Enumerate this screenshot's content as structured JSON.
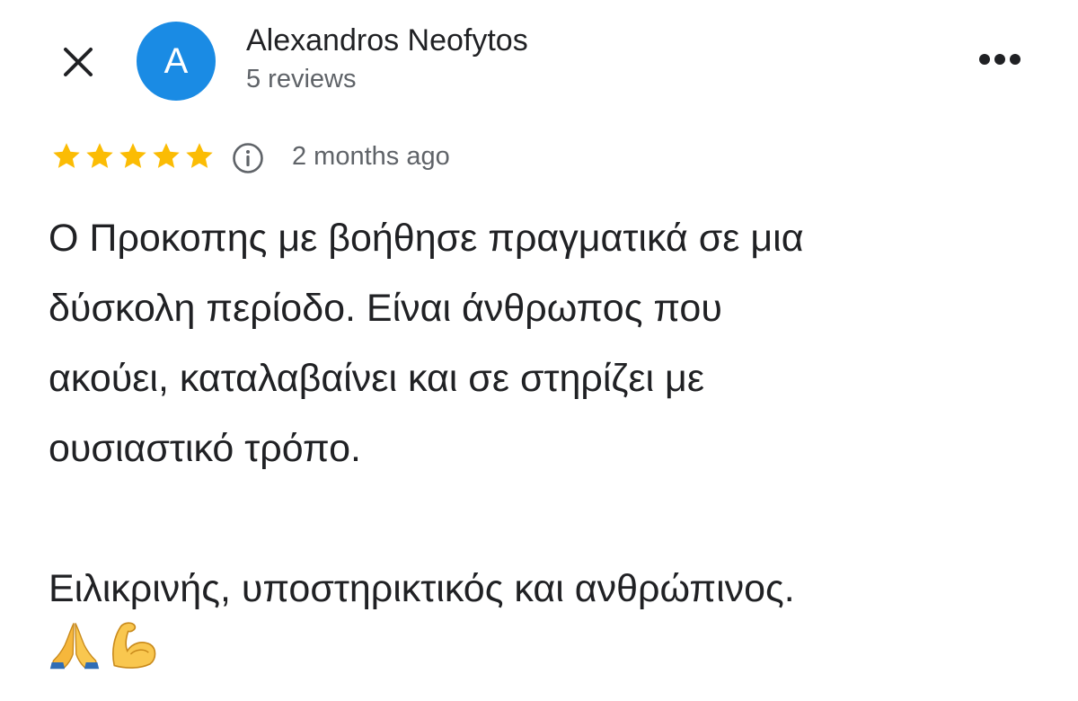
{
  "reviewer": {
    "name": "Alexandros Neofytos",
    "avatar_letter": "A",
    "reviews_count": "5 reviews"
  },
  "icons": {
    "close": "close-icon",
    "more": "more-horiz-icon",
    "info": "info-icon",
    "star": "star-icon"
  },
  "colors": {
    "avatar": "#1a8be4",
    "star": "#fbbc04",
    "secondary_text": "#5f6368",
    "primary_text": "#202124"
  },
  "review": {
    "rating": 5,
    "rating_max": 5,
    "date": "2 months ago",
    "lines": [
      "Ο Προκοπης με βοήθησε πραγματικά σε μια",
      "δύσκολη περίοδο. Είναι άνθρωπος που",
      "ακούει, καταλαβαίνει και σε στηρίζει με",
      "ουσιαστικό τρόπο.",
      "",
      "Ειλικρινής, υποστηρικτικός και ανθρώπινος."
    ],
    "emojis": [
      "folded-hands-emoji",
      "flexed-biceps-emoji"
    ]
  }
}
